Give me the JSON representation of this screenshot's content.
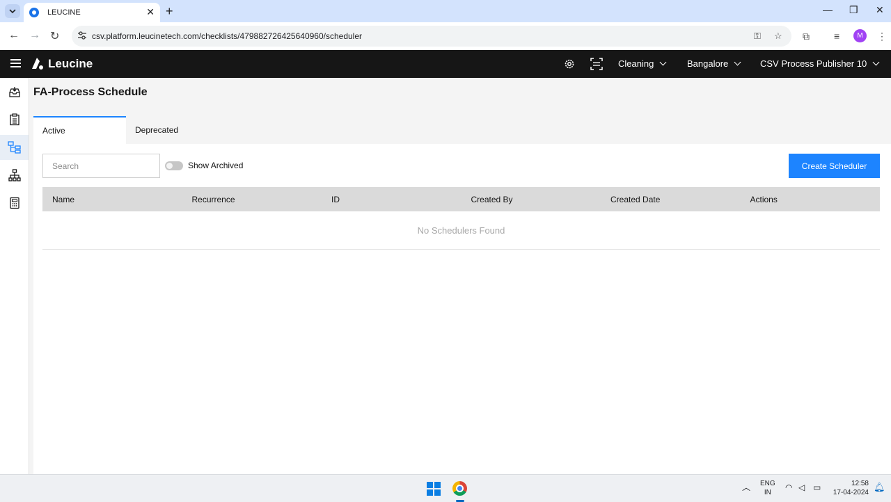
{
  "browser": {
    "tab_title": "LEUCINE",
    "url": "csv.platform.leucinetech.com/checklists/479882726425640960/scheduler",
    "profile_initial": "M"
  },
  "header": {
    "logo_text": "Leucine",
    "use_case": "Cleaning",
    "facility": "Bangalore",
    "user": "CSV Process Publisher 10"
  },
  "page": {
    "title": "FA-Process Schedule",
    "tabs": [
      {
        "label": "Active",
        "active": true
      },
      {
        "label": "Deprecated",
        "active": false
      }
    ],
    "search_placeholder": "Search",
    "show_archived_label": "Show Archived",
    "show_archived": false,
    "create_button": "Create Scheduler",
    "table": {
      "columns": [
        "Name",
        "Recurrence",
        "ID",
        "Created By",
        "Created Date",
        "Actions"
      ],
      "empty_message": "No Schedulers Found"
    }
  },
  "taskbar": {
    "lang_1": "ENG",
    "lang_2": "IN",
    "time": "12:58",
    "date": "17-04-2024"
  },
  "colors": {
    "accent": "#1d84ff",
    "header_bg": "#161616",
    "browser_tabbar": "#d3e3fd"
  }
}
